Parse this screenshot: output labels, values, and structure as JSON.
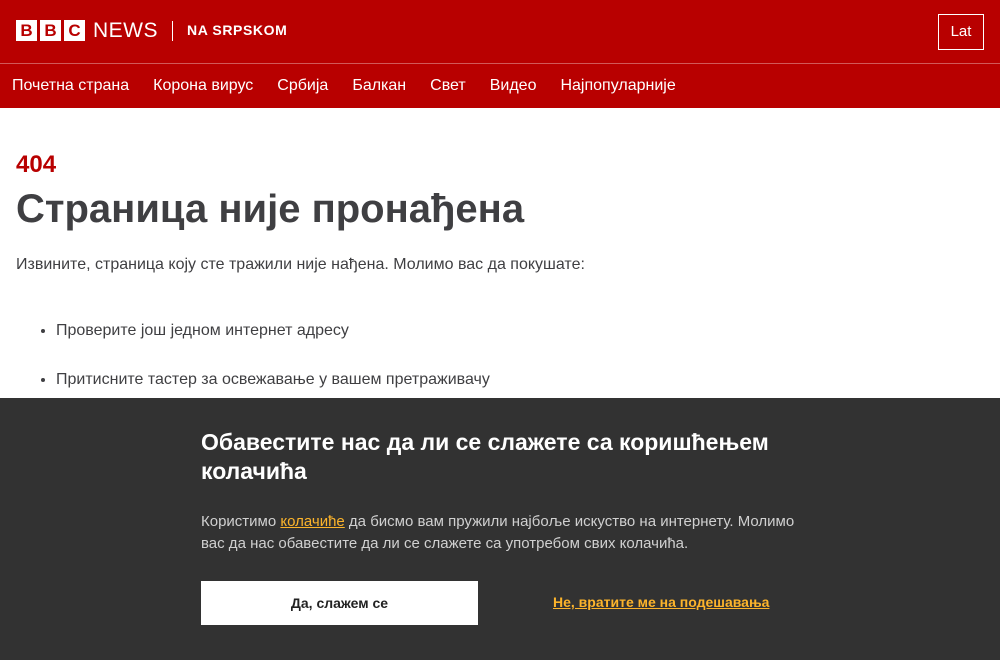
{
  "header": {
    "logo_letters": [
      "B",
      "B",
      "C"
    ],
    "logo_news": "NEWS",
    "service_name": "NA SRPSKOM",
    "lat_button": "Lat",
    "brand_color": "#b80000"
  },
  "nav": {
    "items": [
      "Почетна страна",
      "Корона вирус",
      "Србија",
      "Балкан",
      "Свет",
      "Видео",
      "Најпопуларније"
    ]
  },
  "main": {
    "error_code": "404",
    "title": "Страница није пронађена",
    "lead": "Извините, страница коју сте тражили није нађена. Молимо вас да покушате:",
    "suggestions": [
      "Проверите још једном интернет адресу",
      "Притисните тастер за освежавање у вашем претраживачу"
    ]
  },
  "cookie_banner": {
    "title": "Обавестите нас да ли се слажете са коришћењем колачића",
    "text_before_link": "Користимо ",
    "link_text": "колачиће",
    "text_after_link": " да бисмо вам пружили најбоље искуство на интернету. Молимо вас да нас обавестите да ли се слажете са употребом свих колачића.",
    "accept_label": "Да, слажем се",
    "settings_label": "Не, вратите ме на подешавања",
    "background_color": "#323232",
    "accent_color": "#fcb42b"
  }
}
